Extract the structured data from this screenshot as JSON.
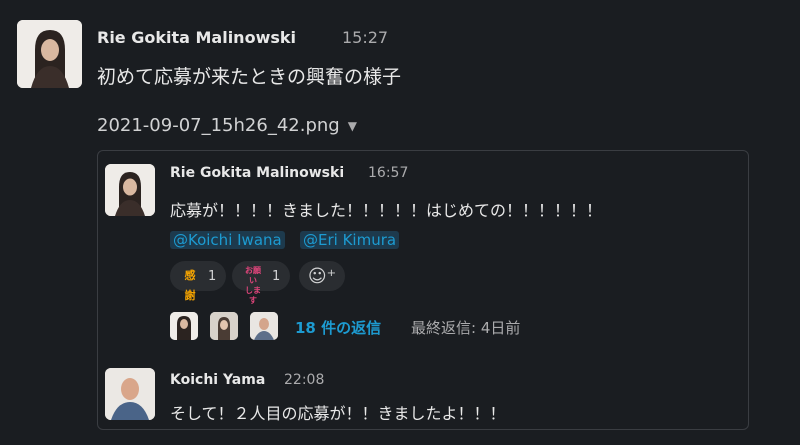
{
  "message": {
    "author": "Rie Gokita Malinowski",
    "time": "15:27",
    "text": "初めて応募が来たときの興奮の様子",
    "file_name": "2021-09-07_15h26_42.png"
  },
  "preview": {
    "author": "Rie Gokita Malinowski",
    "time": "16:57",
    "text": "応募が！！！！きました！！！！！はじめての！！！！！！",
    "mentions": [
      "@Koichi Iwana",
      "@Eri Kimura"
    ],
    "reactions": [
      {
        "emoji": "感謝",
        "count": "1",
        "icon": "kansha-emoji-icon"
      },
      {
        "emoji_line1": "お願い",
        "emoji_line2": "します",
        "count": "1",
        "icon": "onegai-emoji-icon"
      }
    ],
    "add_reaction_icon": "add-reaction-icon",
    "thread": {
      "reply_count": "18 件の返信",
      "last_reply": "最終返信: 4日前"
    },
    "reply": {
      "author": "Koichi Yama",
      "time": "22:08",
      "text": "そして！２人目の応募が！！きましたよ！！！"
    }
  },
  "colors": {
    "background": "#1a1d21",
    "link": "#1d9bd1",
    "mention_bg": "#1d3a4d"
  }
}
